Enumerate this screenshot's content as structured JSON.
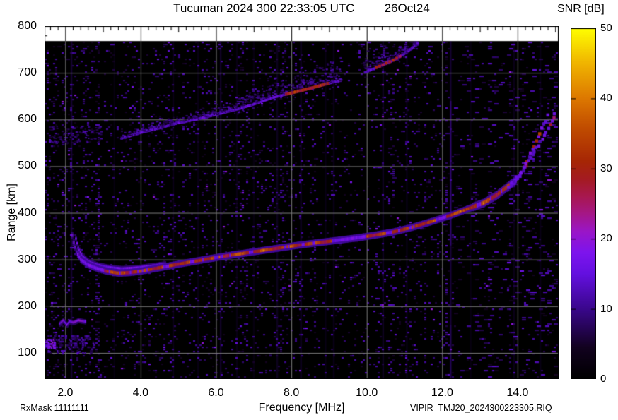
{
  "chart_data": {
    "type": "heatmap",
    "title": "Tucuman 2024 300 22:33:05 UTC",
    "date_label": "26Oct24",
    "xlabel": "Frequency [MHz]",
    "ylabel": "Range [km]",
    "footer_left": "RxMask 11111111",
    "footer_right": "VIPIR  TMJ20_2024300223305.RIQ",
    "xlim": [
      1.45,
      15.09
    ],
    "ylim": [
      44,
      800
    ],
    "data_max_range": 768,
    "xticks": [
      2,
      4,
      6,
      8,
      10,
      12,
      14
    ],
    "xtick_labels": [
      "2.0",
      "4.0",
      "6.0",
      "8.0",
      "10.0",
      "12.0",
      "14.0"
    ],
    "yticks": [
      100,
      200,
      300,
      400,
      500,
      600,
      700,
      800
    ],
    "grid": true,
    "colorbar": {
      "label": "SNR [dB]",
      "min": 0,
      "max": 50,
      "ticks": [
        0,
        10,
        20,
        30,
        40,
        50
      ]
    },
    "colormap_stops": [
      [
        0.0,
        "#000000"
      ],
      [
        0.09,
        "#12021f"
      ],
      [
        0.2,
        "#3a078c"
      ],
      [
        0.3,
        "#6410e0"
      ],
      [
        0.36,
        "#7d14ee"
      ],
      [
        0.42,
        "#9a16c8"
      ],
      [
        0.47,
        "#a51788"
      ],
      [
        0.52,
        "#a81850"
      ],
      [
        0.57,
        "#a41b22"
      ],
      [
        0.62,
        "#a62605"
      ],
      [
        0.72,
        "#c24e00"
      ],
      [
        0.8,
        "#dd7800"
      ],
      [
        0.9,
        "#f0b400"
      ],
      [
        1.0,
        "#ffff00"
      ]
    ],
    "main_trace": {
      "points": [
        [
          2.18,
          352
        ],
        [
          2.22,
          336
        ],
        [
          2.3,
          316
        ],
        [
          2.42,
          300
        ],
        [
          2.6,
          289
        ],
        [
          2.85,
          281
        ],
        [
          3.1,
          275
        ],
        [
          3.4,
          271
        ],
        [
          3.7,
          272
        ],
        [
          4.0,
          275
        ],
        [
          4.4,
          281
        ],
        [
          4.8,
          287
        ],
        [
          5.2,
          293
        ],
        [
          5.7,
          300
        ],
        [
          6.2,
          307
        ],
        [
          6.7,
          313
        ],
        [
          7.2,
          319
        ],
        [
          7.7,
          325
        ],
        [
          8.2,
          331
        ],
        [
          8.7,
          336
        ],
        [
          9.2,
          341
        ],
        [
          9.7,
          346
        ],
        [
          10.2,
          352
        ],
        [
          10.7,
          359
        ],
        [
          11.2,
          369
        ],
        [
          11.7,
          381
        ],
        [
          12.2,
          394
        ],
        [
          12.7,
          409
        ],
        [
          13.1,
          421
        ],
        [
          13.45,
          438
        ],
        [
          13.75,
          457
        ],
        [
          13.95,
          470
        ]
      ],
      "orange_range": [
        3.05,
        13.78
      ],
      "weak_segments": [
        [
          4.6,
          4.75
        ],
        [
          5.32,
          5.45
        ],
        [
          5.95,
          6.1
        ],
        [
          6.88,
          6.98
        ],
        [
          7.8,
          7.9
        ],
        [
          8.55,
          8.65
        ],
        [
          9.08,
          10.0
        ],
        [
          10.52,
          10.64
        ],
        [
          11.85,
          12.12
        ],
        [
          12.95,
          13.02
        ]
      ]
    },
    "x_cusp": {
      "points": [
        [
          2.28,
          345
        ],
        [
          2.34,
          325
        ],
        [
          2.45,
          308
        ],
        [
          2.62,
          296
        ],
        [
          2.85,
          289
        ],
        [
          3.15,
          284
        ],
        [
          3.5,
          281
        ],
        [
          3.9,
          283
        ],
        [
          4.3,
          287
        ],
        [
          4.65,
          291
        ]
      ]
    },
    "steep_o": {
      "f0": 13.95,
      "f1": 14.8,
      "r0": 470,
      "r1": 608,
      "exp": 1.18,
      "orange_dots": [
        [
          14.22,
          29
        ],
        [
          14.47,
          31
        ],
        [
          14.6,
          34
        ]
      ]
    },
    "steep_x": {
      "f0": 13.78,
      "f1": 15.0,
      "r0": 452,
      "r1": 612,
      "exp": 1.15,
      "orange_dots": [
        [
          14.85,
          28
        ],
        [
          14.95,
          24
        ]
      ]
    },
    "second_hop": {
      "edge_points": [
        [
          3.5,
          560
        ],
        [
          4.0,
          572
        ],
        [
          4.5,
          582
        ],
        [
          5.0,
          593
        ],
        [
          5.5,
          601
        ],
        [
          6.1,
          613
        ],
        [
          6.6,
          623
        ],
        [
          7.0,
          633
        ],
        [
          7.5,
          647
        ],
        [
          8.0,
          657
        ],
        [
          8.5,
          667
        ],
        [
          9.0,
          678
        ],
        [
          9.3,
          684
        ],
        [
          9.95,
          701
        ],
        [
          10.3,
          713
        ],
        [
          10.7,
          727
        ],
        [
          11.0,
          741
        ],
        [
          11.2,
          753
        ],
        [
          11.35,
          763
        ]
      ],
      "segments": [
        [
          3.5,
          9.3
        ],
        [
          9.95,
          11.35
        ]
      ],
      "orange_core": [
        7.85,
        9.0
      ],
      "orange_dots_range": [
        10.25,
        10.95
      ],
      "fuzz_height": [
        [
          3.5,
          14
        ],
        [
          5.0,
          22
        ],
        [
          6.5,
          30
        ],
        [
          7.5,
          45
        ],
        [
          8.2,
          60
        ],
        [
          9.3,
          55
        ],
        [
          10.0,
          55
        ],
        [
          11.3,
          40
        ]
      ],
      "lowf_fuzz": {
        "f": [
          1.6,
          2.95
        ],
        "r": [
          548,
          588
        ]
      }
    },
    "es_layer": {
      "zigzag": [
        [
          1.85,
          162
        ],
        [
          1.95,
          170
        ],
        [
          2.05,
          160
        ],
        [
          2.12,
          168
        ],
        [
          2.22,
          165
        ],
        [
          2.35,
          170
        ],
        [
          2.55,
          167
        ]
      ],
      "blob": {
        "f": [
          1.55,
          2.75
        ],
        "r": [
          102,
          140
        ],
        "density": 0.3
      },
      "bright": {
        "f": [
          1.45,
          1.75
        ],
        "r": [
          112,
          132
        ],
        "density": 0.55
      }
    },
    "rfi_stripes": [
      {
        "f": 12.22,
        "segs": [
          [
            768,
            640,
            0.3
          ],
          [
            640,
            330,
            0.65
          ],
          [
            330,
            160,
            0.35
          ],
          [
            160,
            44,
            0.5
          ]
        ]
      },
      {
        "f": 2.16,
        "a": 0.3
      },
      {
        "f": 3.3,
        "a": 0.1
      },
      {
        "f": 4.86,
        "a": 0.15
      },
      {
        "f": 5.52,
        "a": 0.12
      },
      {
        "f": 6.12,
        "a": 0.25
      },
      {
        "f": 6.55,
        "a": 0.12
      },
      {
        "f": 7.0,
        "a": 0.1
      },
      {
        "f": 7.62,
        "a": 0.18
      },
      {
        "f": 8.25,
        "a": 0.2
      },
      {
        "f": 8.9,
        "a": 0.12
      },
      {
        "f": 9.12,
        "a": 0.15
      },
      {
        "f": 10.43,
        "a": 0.2
      },
      {
        "f": 11.06,
        "a": 0.12
      },
      {
        "f": 12.75,
        "a": 0.1
      },
      {
        "f": 13.9,
        "a": 0.15
      },
      {
        "f": 14.6,
        "a": 0.12
      }
    ],
    "noise": {
      "seed": 1337,
      "density": 0.1
    }
  }
}
